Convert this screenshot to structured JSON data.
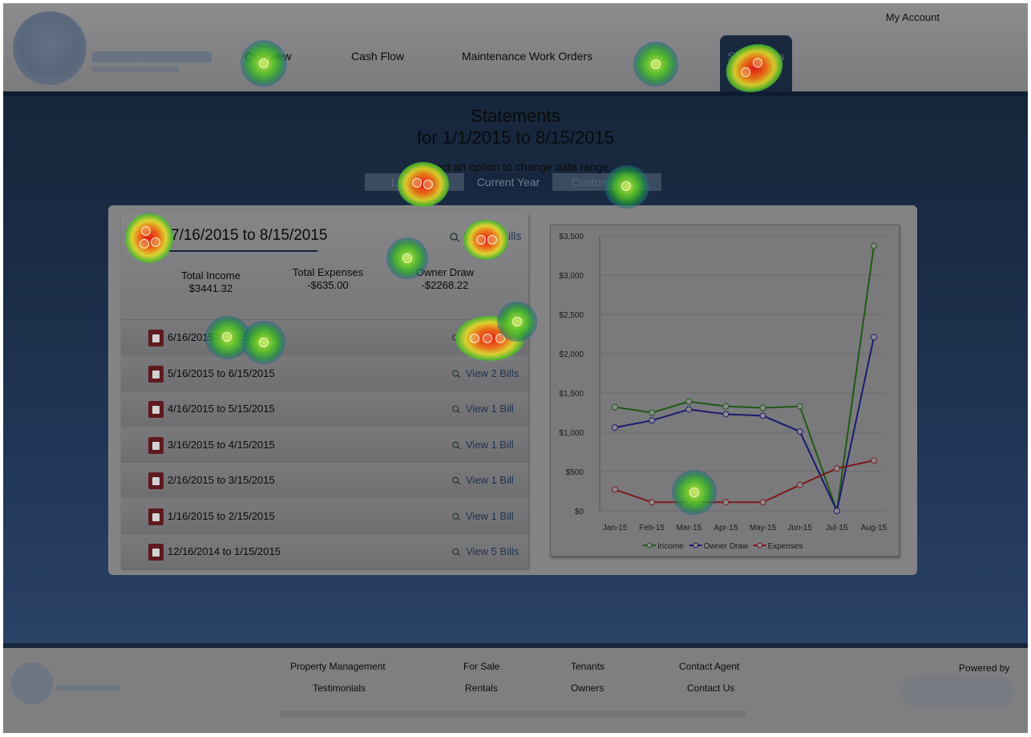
{
  "header": {
    "my_account": "My Account",
    "nav": [
      "Overview",
      "Cash Flow",
      "Maintenance Work Orders",
      "Bills",
      "Statements"
    ],
    "active_tab": "Statements"
  },
  "page": {
    "title": "Statements",
    "subtitle": "for 1/1/2015 to 8/15/2015",
    "range_label": "Select an option to change date range:",
    "range_options": [
      "Last Year",
      "Current Year",
      "Custom Dates"
    ],
    "selected_range": "Current Year"
  },
  "summary": {
    "date_range": "7/16/2015 to 8/15/2015",
    "view_bills": "View 4 Bills",
    "total_income_label": "Total Income",
    "total_income": "$3441.32",
    "total_expenses_label": "Total Expenses",
    "total_expenses": "-$635.00",
    "owner_draw_label": "Owner Draw",
    "owner_draw": "-$2268.22"
  },
  "statements": [
    {
      "date": "6/16/2015 to 7/15/2015",
      "view": "View 1 Bill"
    },
    {
      "date": "5/16/2015 to 6/15/2015",
      "view": "View 2 Bills"
    },
    {
      "date": "4/16/2015 to 5/15/2015",
      "view": "View 1 Bill"
    },
    {
      "date": "3/16/2015 to 4/15/2015",
      "view": "View 1 Bill"
    },
    {
      "date": "2/16/2015 to 3/15/2015",
      "view": "View 1 Bill"
    },
    {
      "date": "1/16/2015 to 2/15/2015",
      "view": "View 1 Bill"
    },
    {
      "date": "12/16/2014 to 1/15/2015",
      "view": "View 5 Bills"
    }
  ],
  "chart_data": {
    "type": "line",
    "categories": [
      "Jan-15",
      "Feb-15",
      "Mar-15",
      "Apr-15",
      "May-15",
      "Jun-15",
      "Jul-15",
      "Aug-15"
    ],
    "yticks": [
      "$0",
      "$500",
      "$1,000",
      "$1,500",
      "$2,000",
      "$2,500",
      "$3,000",
      "$3,500"
    ],
    "ylim": [
      0,
      3500
    ],
    "grid": true,
    "legend": "bottom",
    "series": [
      {
        "name": "Income",
        "color": "#1d5a12",
        "values": [
          1320,
          1250,
          1390,
          1330,
          1310,
          1330,
          0,
          3370
        ]
      },
      {
        "name": "Owner Draw",
        "color": "#1a1a6e",
        "values": [
          1060,
          1150,
          1290,
          1230,
          1210,
          1010,
          0,
          2210
        ]
      },
      {
        "name": "Expenses",
        "color": "#7a1a1a",
        "values": [
          270,
          110,
          110,
          110,
          110,
          330,
          540,
          640
        ]
      }
    ]
  },
  "footer": {
    "links_row1": [
      "Property Management",
      "For Sale",
      "Tenants",
      "Contact Agent"
    ],
    "links_row2": [
      "Testimonials",
      "Rentals",
      "Owners",
      "Contact Us"
    ],
    "powered_by": "Powered by"
  }
}
